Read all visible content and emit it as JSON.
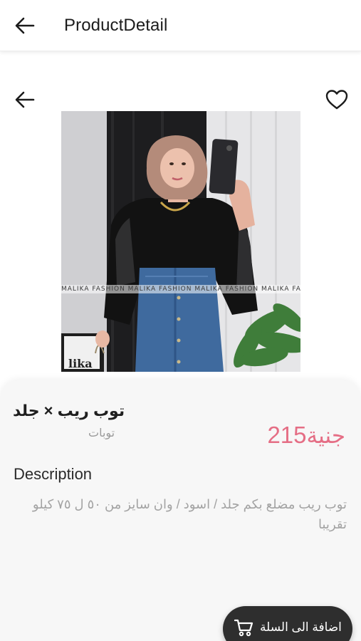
{
  "appbar": {
    "title": "ProductDetail",
    "back_icon": "arrow-left-icon"
  },
  "image_area": {
    "back_icon": "arrow-left-icon",
    "favorite_icon": "heart-outline-icon",
    "watermark": "MALIKA FASHION MALIKA FASHION MALIKA FASHION MALIKA FASHION",
    "sign_text": "lika"
  },
  "product": {
    "name": "توب ريب × جلد",
    "category": "توبات",
    "price_value": "215",
    "price_currency": "جنية",
    "description_heading": "Description",
    "description": "توب ريب مضلع بكم جلد / اسود / وان سايز من ٥٠ ل ٧٥ كيلو تقريبا"
  },
  "cart_button": {
    "label": "اضافة الى السلة",
    "icon": "cart-icon"
  },
  "colors": {
    "accent_price": "#e56e85",
    "button_bg": "#2e2e2e",
    "sheet_bg": "#f7f7f7"
  }
}
